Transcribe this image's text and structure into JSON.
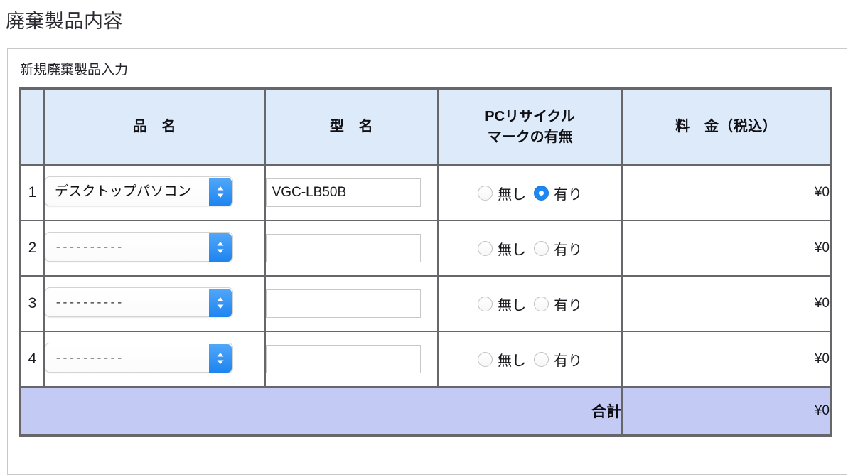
{
  "page": {
    "title": "廃棄製品内容"
  },
  "panel": {
    "caption": "新規廃棄製品入力"
  },
  "table": {
    "headers": {
      "num": "",
      "name": "品　名",
      "model": "型　名",
      "mark_line1": "PCリサイクル",
      "mark_line2": "マークの有無",
      "price": "料　金（税込）"
    },
    "rows": [
      {
        "num": "1",
        "product": "デスクトップパソコン",
        "model_value": "VGC-LB50B",
        "mark_none_label": "無し",
        "mark_has_label": "有り",
        "mark_selected": "有り",
        "price": "¥0"
      },
      {
        "num": "2",
        "product": "----------",
        "model_value": "",
        "mark_none_label": "無し",
        "mark_has_label": "有り",
        "mark_selected": "",
        "price": "¥0"
      },
      {
        "num": "3",
        "product": "----------",
        "model_value": "",
        "mark_none_label": "無し",
        "mark_has_label": "有り",
        "mark_selected": "",
        "price": "¥0"
      },
      {
        "num": "4",
        "product": "----------",
        "model_value": "",
        "mark_none_label": "無し",
        "mark_has_label": "有り",
        "mark_selected": "",
        "price": "¥0"
      }
    ],
    "total": {
      "label": "合計",
      "value": "¥0"
    }
  },
  "colors": {
    "header_bg": "#dceaf9",
    "total_bg": "#c3cbf5",
    "accent": "#1d88f5",
    "border": "#66666b"
  }
}
